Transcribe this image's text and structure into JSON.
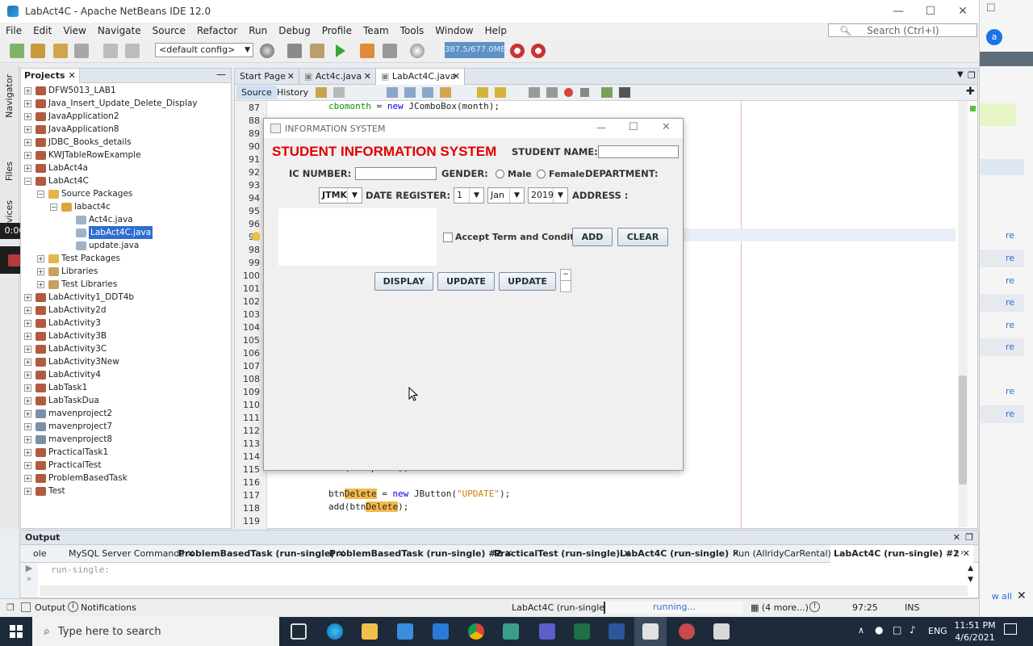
{
  "window": {
    "title": "LabAct4C - Apache NetBeans IDE 12.0"
  },
  "menu": [
    "File",
    "Edit",
    "View",
    "Navigate",
    "Source",
    "Refactor",
    "Run",
    "Debug",
    "Profile",
    "Team",
    "Tools",
    "Window",
    "Help"
  ],
  "search": {
    "placeholder": "Search (Ctrl+I)"
  },
  "toolbar": {
    "config": "<default config>",
    "memory": "387.5/677.0MB"
  },
  "sidebar_strip": {
    "navigator": "Navigator",
    "files": "Files",
    "services": "ervices"
  },
  "recorder": {
    "time": "0:00"
  },
  "projects": {
    "tab": "Projects",
    "items": [
      {
        "label": "DFW5013_LAB1"
      },
      {
        "label": "Java_Insert_Update_Delete_Display"
      },
      {
        "label": "JavaApplication2"
      },
      {
        "label": "JavaApplication8"
      },
      {
        "label": "JDBC_Books_details"
      },
      {
        "label": "KWJTableRowExample"
      },
      {
        "label": "LabAct4a"
      },
      {
        "label": "LabAct4C"
      },
      {
        "label": "Source Packages"
      },
      {
        "label": "labact4c"
      },
      {
        "label": "Act4c.java"
      },
      {
        "label": "LabAct4C.java"
      },
      {
        "label": "update.java"
      },
      {
        "label": "Test Packages"
      },
      {
        "label": "Libraries"
      },
      {
        "label": "Test Libraries"
      },
      {
        "label": "LabActivity1_DDT4b"
      },
      {
        "label": "LabActivity2d"
      },
      {
        "label": "LabActivity3"
      },
      {
        "label": "LabActivity3B"
      },
      {
        "label": "LabActivity3C"
      },
      {
        "label": "LabActivity3New"
      },
      {
        "label": "LabActivity4"
      },
      {
        "label": "LabTask1"
      },
      {
        "label": "LabTaskDua"
      },
      {
        "label": "mavenproject2"
      },
      {
        "label": "mavenproject7"
      },
      {
        "label": "mavenproject8"
      },
      {
        "label": "PracticalTask1"
      },
      {
        "label": "PracticalTest"
      },
      {
        "label": "ProblemBasedTask"
      },
      {
        "label": "Test"
      }
    ]
  },
  "editor": {
    "tabs": [
      "Start Page",
      "Act4c.java",
      "LabAct4C.java"
    ],
    "source": "Source",
    "history": "History",
    "lines": [
      "87",
      "88",
      "89",
      "90",
      "91",
      "92",
      "93",
      "94",
      "95",
      "96",
      "97",
      "98",
      "99",
      "100",
      "101",
      "102",
      "103",
      "104",
      "105",
      "106",
      "107",
      "108",
      "109",
      "110",
      "111",
      "112",
      "113",
      "114",
      "115",
      "116",
      "117",
      "118",
      "119"
    ],
    "code": {
      "l87a": "cbomonth",
      "l87b": " = ",
      "l87c": "new",
      "l87d": " JComboBox(month);",
      "l117a": "btn",
      "l117b": "Delete",
      "l117c": " = ",
      "l117d": "new",
      "l117e": " JButton(",
      "l117f": "\"UPDATE\"",
      "l117g": ");",
      "l118a": "add(btn",
      "l118b": "Delete",
      "l118c": ");",
      "l115": "add(btnUpdate);"
    }
  },
  "dialog": {
    "title": "INFORMATION SYSTEM",
    "heading": "STUDENT INFORMATION SYSTEM",
    "student_name": "STUDENT NAME:",
    "ic_number": "IC NUMBER:",
    "gender": "GENDER:",
    "male": "Male",
    "female": "Female",
    "department": "DEPARTMENT:",
    "dept_value": "JTMK",
    "date_register": "DATE REGISTER:",
    "day": "1",
    "month": "Jan",
    "year": "2019",
    "address": "ADDRESS :",
    "accept": "Accept Term and Condition",
    "add": "ADD",
    "clear": "CLEAR",
    "display": "DISPLAY",
    "update1": "UPDATE",
    "update2": "UPDATE"
  },
  "output": {
    "title": "Output",
    "tabs": [
      "ole",
      "MySQL Server Commands",
      "ProblemBasedTask (run-single)",
      "ProblemBasedTask (run-single) #2",
      "PracticalTest (run-single)",
      "LabAct4C (run-single)",
      "Run (AllridyCarRental)",
      "LabAct4C (run-single) #2"
    ],
    "text": "run-single:"
  },
  "status": {
    "output": "Output",
    "notifications": "Notifications",
    "task": "LabAct4C (run-single) #2",
    "running": "running...",
    "more": "(4 more...)",
    "pos": "97:25",
    "mode": "INS"
  },
  "taskbar": {
    "search": "Type here to search",
    "time": "11:51 PM",
    "date": "4/6/2021",
    "lang": "ENG"
  },
  "rightpanel": {
    "items": [
      "re",
      "re",
      "re",
      "re",
      "re",
      "re",
      "re",
      "re"
    ],
    "viewall": "w all"
  },
  "colors": {
    "accent": "#2f6ed1",
    "heading_red": "#e00000"
  }
}
